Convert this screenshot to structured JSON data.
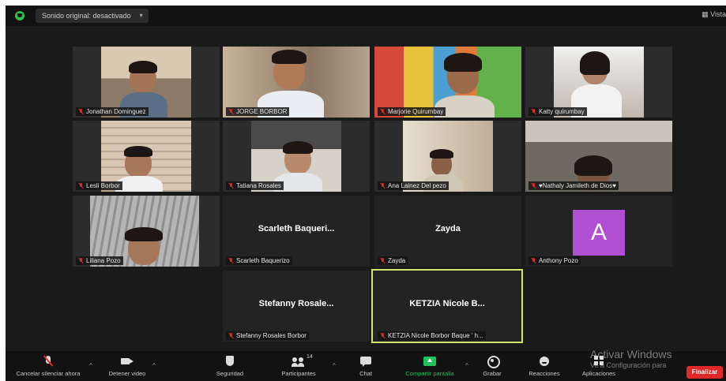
{
  "topbar": {
    "audio_label": "Sonido original: desactivado",
    "view_label": "Vista"
  },
  "participants": [
    {
      "name": "Jonathan Dominguez",
      "muted": true,
      "video": true
    },
    {
      "name": "JORGE BORBOR",
      "muted": true,
      "video": true
    },
    {
      "name": "Marjorie Quirumbay",
      "muted": true,
      "video": true
    },
    {
      "name": "Katty quirumbay",
      "muted": true,
      "video": true
    },
    {
      "name": "Lesli Borbor",
      "muted": true,
      "video": true
    },
    {
      "name": "Tatiana Rosales",
      "muted": true,
      "video": true
    },
    {
      "name": "Ana Lainez Del pezo",
      "muted": true,
      "video": true
    },
    {
      "name": "♥Nathaly Jamileth de Dios♥",
      "muted": true,
      "video": true
    },
    {
      "name": "Liliana Pozo",
      "muted": true,
      "video": true
    },
    {
      "name": "Scarleth Baquerizo",
      "display_name": "Scarleth  Baqueri...",
      "muted": true,
      "video": false
    },
    {
      "name": "Zayda",
      "display_name": "Zayda",
      "muted": true,
      "video": false
    },
    {
      "name": "Anthony Pozo",
      "avatar_letter": "A",
      "avatar_color": "#b04fd2",
      "muted": true,
      "video": false
    },
    {
      "name": "Stefanny Rosales Borbor",
      "display_name": "Stefanny  Rosale...",
      "muted": true,
      "video": false
    },
    {
      "name": "KETZIA Nicole Borbor Baque ' h...",
      "display_name": "KETZIA  Nicole  B...",
      "muted": true,
      "video": false,
      "active_speaker": true
    }
  ],
  "toolbar": {
    "unmute_label": "Cancelar silenciar ahora",
    "stop_video_label": "Detener video",
    "security_label": "Seguridad",
    "participants_label": "Participantes",
    "participants_count": "14",
    "chat_label": "Chat",
    "share_label": "Compartir pantalla",
    "record_label": "Grabar",
    "reactions_label": "Reacciones",
    "apps_label": "Aplicaciones",
    "end_label": "Finalizar"
  },
  "watermark": {
    "line1": "Activar Windows",
    "line2": "Ve a Configuración para"
  },
  "colors": {
    "share_green": "#20c05c",
    "end_red": "#e02828",
    "active_speaker_border": "#cfe66a",
    "avatar_purple": "#b04fd2"
  }
}
